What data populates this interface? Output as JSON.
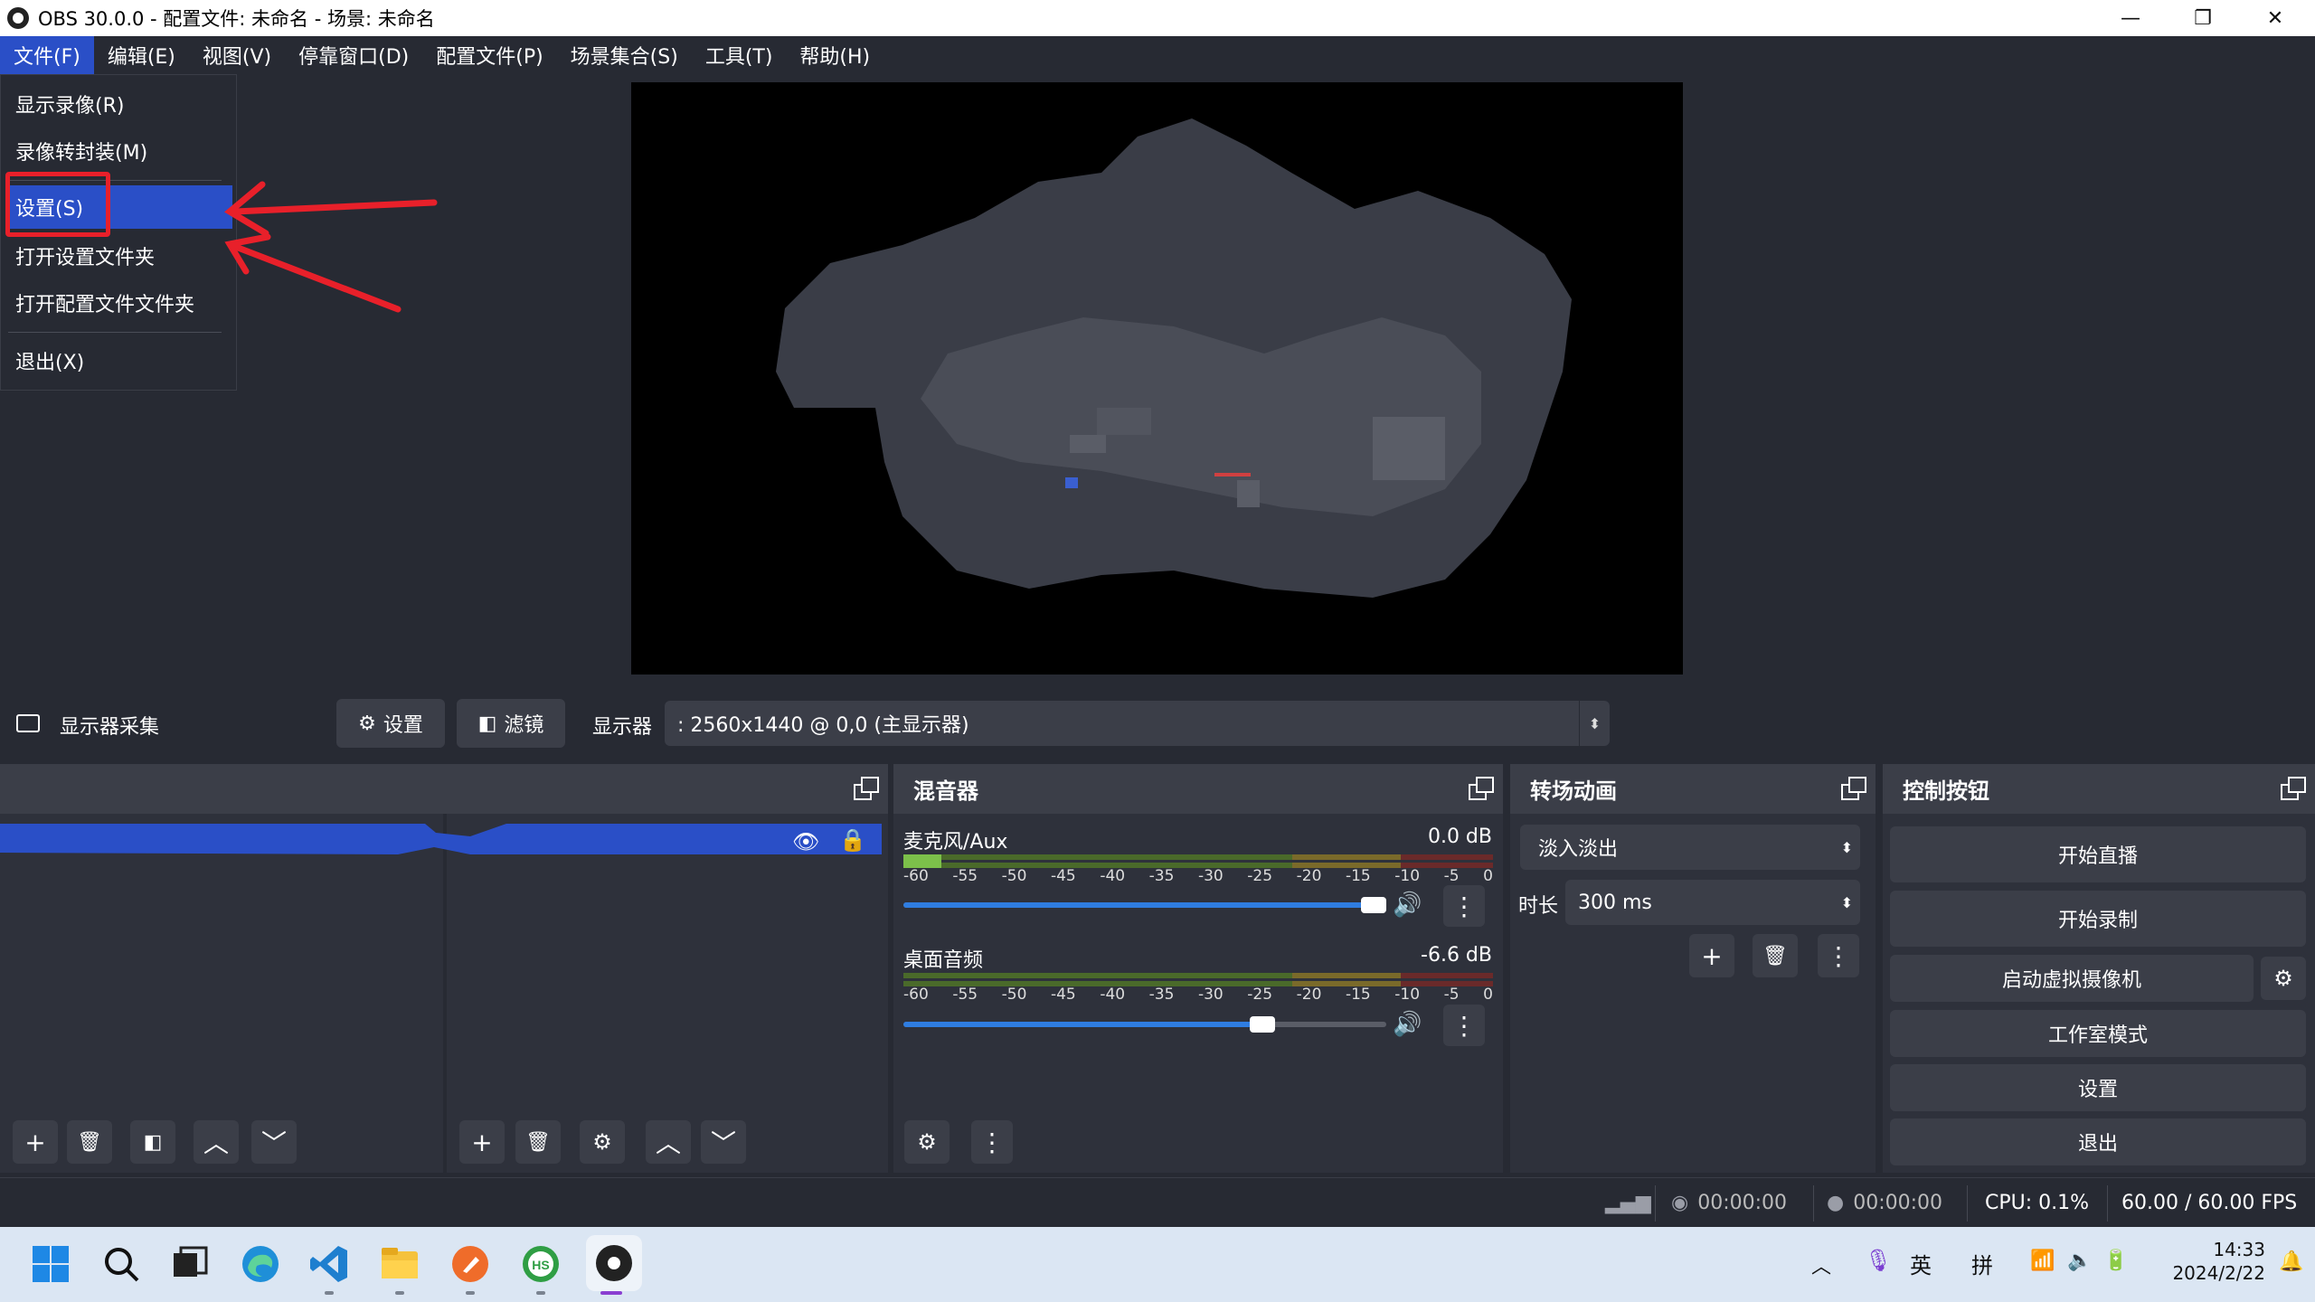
{
  "window": {
    "title": "OBS 30.0.0 - 配置文件: 未命名 - 场景: 未命名",
    "minimize": "—",
    "restore": "❐",
    "close": "✕"
  },
  "menubar": {
    "items": [
      "文件(F)",
      "编辑(E)",
      "视图(V)",
      "停靠窗口(D)",
      "配置文件(P)",
      "场景集合(S)",
      "工具(T)",
      "帮助(H)"
    ],
    "active_index": 0
  },
  "file_menu": {
    "items": [
      "显示录像(R)",
      "录像转封装(M)",
      "设置(S)",
      "打开设置文件夹",
      "打开配置文件文件夹",
      "退出(X)"
    ],
    "highlighted_index": 2
  },
  "source_toolbar": {
    "source_name": "显示器采集",
    "settings_label": "设置",
    "filters_label": "滤镜",
    "display_label": "显示器",
    "display_value": ": 2560x1440 @ 0,0 (主显示器)"
  },
  "mixer": {
    "title": "混音器",
    "scale": [
      "-60",
      "-55",
      "-50",
      "-45",
      "-40",
      "-35",
      "-30",
      "-25",
      "-20",
      "-15",
      "-10",
      "-5",
      "0"
    ],
    "channels": [
      {
        "name": "麦克风/Aux",
        "db": "0.0 dB",
        "volume": 1.0
      },
      {
        "name": "桌面音频",
        "db": "-6.6 dB",
        "volume": 0.77
      }
    ]
  },
  "transitions": {
    "title": "转场动画",
    "selected": "淡入淡出",
    "duration_label": "时长",
    "duration_value": "300 ms"
  },
  "controls": {
    "title": "控制按钮",
    "buttons": [
      "开始直播",
      "开始录制",
      "启动虚拟摄像机",
      "工作室模式",
      "设置",
      "退出"
    ]
  },
  "statusbar": {
    "stream_time": "00:00:00",
    "record_time": "00:00:00",
    "cpu": "CPU: 0.1%",
    "fps": "60.00 / 60.00 FPS"
  },
  "taskbar": {
    "ime_lang": "英",
    "ime_mode": "拼",
    "time": "14:33",
    "date": "2024/2/22",
    "apps": [
      "windows-start",
      "search",
      "task-view",
      "edge",
      "vscode",
      "file-explorer",
      "postman",
      "hbuilder",
      "obs"
    ]
  },
  "colors": {
    "accent": "#2a4fc7",
    "panel": "#2e313b",
    "bg": "#272a33",
    "annotation": "#e8202a"
  }
}
